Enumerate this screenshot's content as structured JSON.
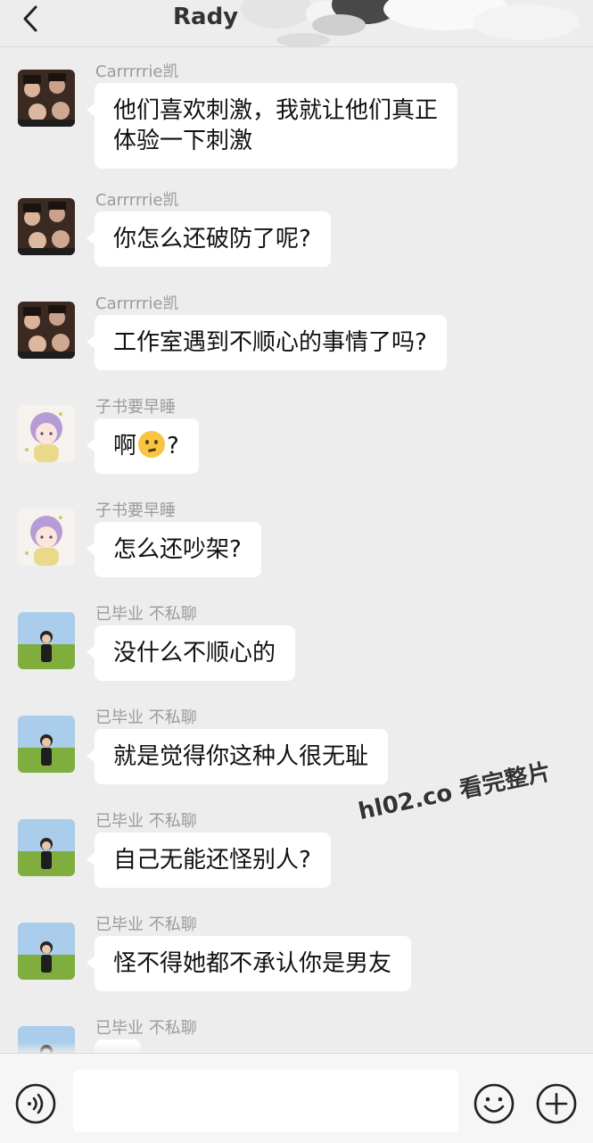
{
  "header": {
    "title": "Rady",
    "back_icon": "chevron-left-icon"
  },
  "watermark": "hl02.co 看完整片",
  "messages": [
    {
      "sender": "Carrrrrie凯",
      "avatar": "group-photo-avatar",
      "text": "他们喜欢刺激，我就让他们真正",
      "text2": "体验一下刺激"
    },
    {
      "sender": "Carrrrrie凯",
      "avatar": "group-photo-avatar",
      "text": "你怎么还破防了呢?"
    },
    {
      "sender": "Carrrrrie凯",
      "avatar": "group-photo-avatar",
      "text": "工作室遇到不顺心的事情了吗?"
    },
    {
      "sender": "子书要早睡",
      "avatar": "anime-girl-avatar",
      "text": "啊",
      "text_after_emoji": "?",
      "emoji": "thinking-face-emoji"
    },
    {
      "sender": "子书要早睡",
      "avatar": "anime-girl-avatar",
      "text": "怎么还吵架?"
    },
    {
      "sender": "已毕业 不私聊",
      "avatar": "field-girl-avatar",
      "text": "没什么不顺心的"
    },
    {
      "sender": "已毕业 不私聊",
      "avatar": "field-girl-avatar",
      "text": "就是觉得你这种人很无耻"
    },
    {
      "sender": "已毕业 不私聊",
      "avatar": "field-girl-avatar",
      "text": "自己无能还怪别人?"
    },
    {
      "sender": "已毕业 不私聊",
      "avatar": "field-girl-avatar",
      "text": "怪不得她都不承认你是男友"
    },
    {
      "sender": "已毕业 不私聊",
      "avatar": "field-girl-avatar"
    }
  ],
  "input_bar": {
    "voice_icon": "voice-icon",
    "emoji_icon": "smiley-icon",
    "plus_icon": "plus-icon",
    "placeholder": ""
  },
  "colors": {
    "background": "#ededed",
    "bubble": "#ffffff",
    "sender_text": "#9b9b9b"
  }
}
